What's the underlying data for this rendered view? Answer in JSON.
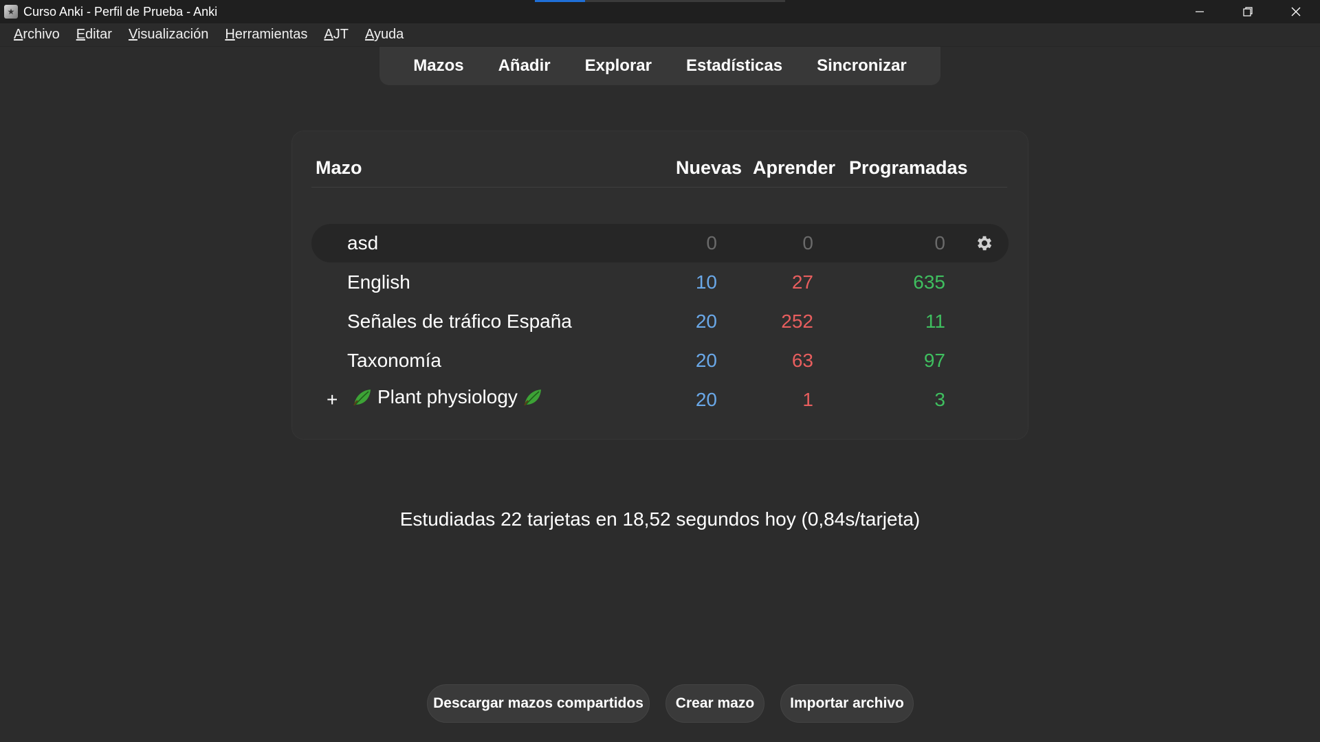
{
  "window": {
    "title": "Curso Anki - Perfil de Prueba - Anki",
    "icon": "anki-icon",
    "progress_fraction": 0.2,
    "controls": [
      "minimize-icon",
      "restore-icon",
      "close-icon"
    ]
  },
  "menu": [
    {
      "first": "A",
      "rest": "rchivo"
    },
    {
      "first": "E",
      "rest": "ditar"
    },
    {
      "first": "V",
      "rest": "isualización"
    },
    {
      "first": "H",
      "rest": "erramientas"
    },
    {
      "first": "A",
      "rest": "JT"
    },
    {
      "first": "A",
      "rest": "yuda"
    }
  ],
  "toolbar": {
    "decks": "Mazos",
    "add": "Añadir",
    "browse": "Explorar",
    "stats": "Estadísticas",
    "sync": "Sincronizar"
  },
  "table": {
    "headers": {
      "deck": "Mazo",
      "new": "Nuevas",
      "learn": "Aprender",
      "due": "Programadas"
    },
    "rows": [
      {
        "name": "asd",
        "new": "0",
        "learn": "0",
        "due": "0",
        "selected": true
      },
      {
        "name": "English",
        "new": "10",
        "learn": "27",
        "due": "635"
      },
      {
        "name": "Señales de tráfico España",
        "new": "20",
        "learn": "252",
        "due": "11"
      },
      {
        "name": "Taxonomía",
        "new": "20",
        "learn": "63",
        "due": "97"
      },
      {
        "name": "Plant physiology",
        "new": "20",
        "learn": "1",
        "due": "3",
        "expander": "+",
        "icon": "leaf-icon"
      }
    ]
  },
  "colors": {
    "new": "#6aa8e8",
    "learn": "#e85e5e",
    "due": "#3fbf5f",
    "zero": "#6a6a6a"
  },
  "stats_text": "Estudiadas 22 tarjetas en 18,52 segundos hoy (0,84s/tarjeta)",
  "buttons": {
    "shared": "Descargar mazos compartidos",
    "create": "Crear mazo",
    "import": "Importar archivo"
  }
}
